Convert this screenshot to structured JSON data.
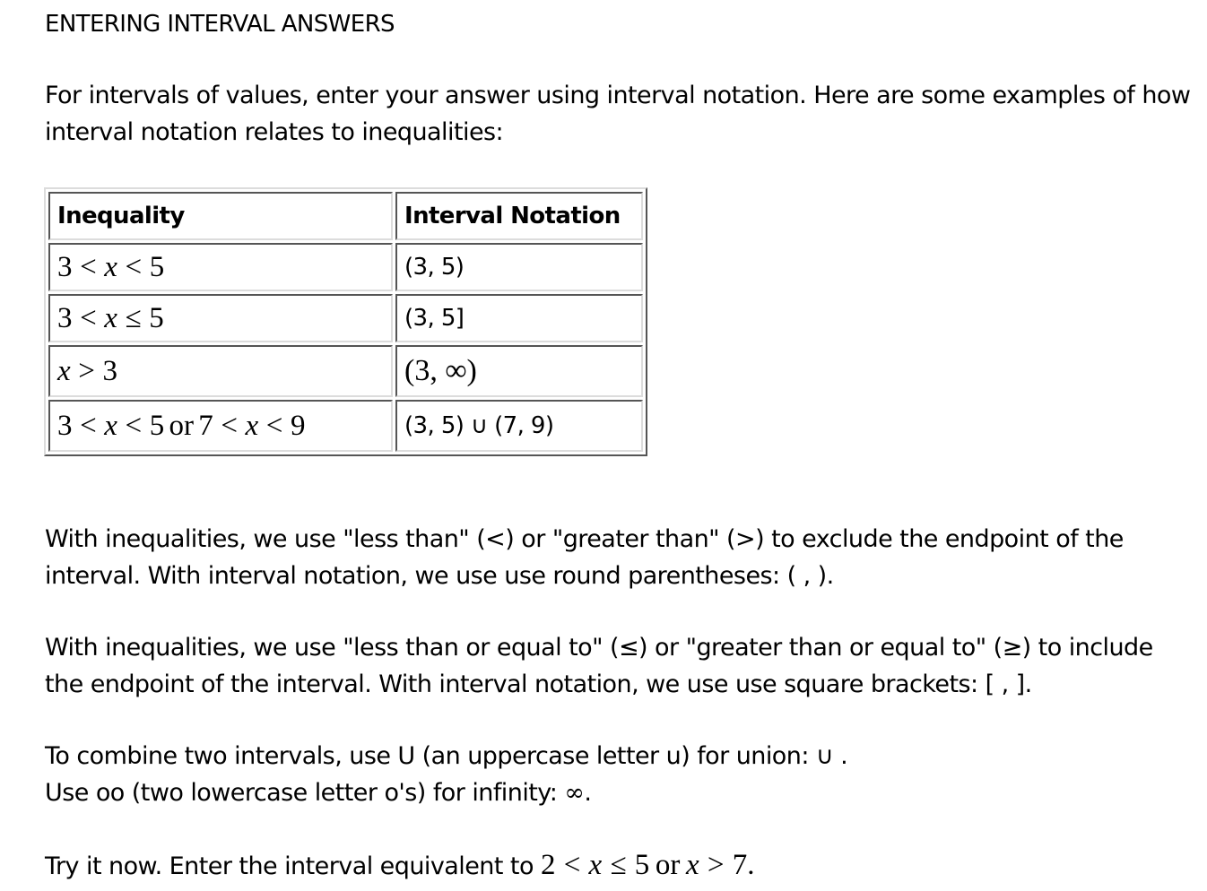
{
  "title": "ENTERING INTERVAL ANSWERS",
  "intro": "For intervals of values, enter your answer using interval notation. Here are some examples of how interval notation relates to inequalities:",
  "table": {
    "headers": [
      "Inequality",
      "Interval Notation"
    ],
    "rows": [
      {
        "inequality": {
          "a": "3",
          "op1": "<",
          "x": "x",
          "op2": "<",
          "b": "5"
        },
        "interval": "(3, 5)"
      },
      {
        "inequality": {
          "a": "3",
          "op1": "<",
          "x": "x",
          "op2": "≤",
          "b": "5"
        },
        "interval": "(3, 5]"
      },
      {
        "inequality": {
          "x": "x",
          "op1": ">",
          "a": "3"
        },
        "interval": "(3, ∞)"
      },
      {
        "inequality": {
          "a": "3",
          "op1": "<",
          "x": "x",
          "op2": "<",
          "b": "5",
          "join": "or",
          "c": "7",
          "op3": "<",
          "x2": "x",
          "op4": "<",
          "d": "9"
        },
        "interval": {
          "left": "(3, 5)",
          "union": "∪",
          "right": "(7, 9)"
        }
      }
    ]
  },
  "exclude_paragraph": "With inequalities, we use \"less than\" (<) or \"greater than\" (>) to exclude the endpoint of the interval. With interval notation, we use use round parentheses: ( , ).",
  "include_paragraph": "With inequalities, we use \"less than or equal to\" (≤) or \"greater than or equal to\" (≥) to include the endpoint of the interval. With interval notation, we use use square brackets: [ , ].",
  "combine": {
    "union_text": "To combine two intervals, use U (an uppercase letter u) for union: ",
    "union_symbol": "∪",
    "union_end": " .",
    "infinity_text": "Use oo (two lowercase letter o's) for infinity: ",
    "infinity_symbol": "∞",
    "infinity_end": "."
  },
  "try_it": {
    "text": "Try it now. Enter the interval equivalent to ",
    "math": {
      "a": "2",
      "op1": "<",
      "x": "x",
      "op2": "≤",
      "b": "5",
      "join": "or",
      "x2": "x",
      "op3": ">",
      "c": "7"
    },
    "end": "."
  }
}
